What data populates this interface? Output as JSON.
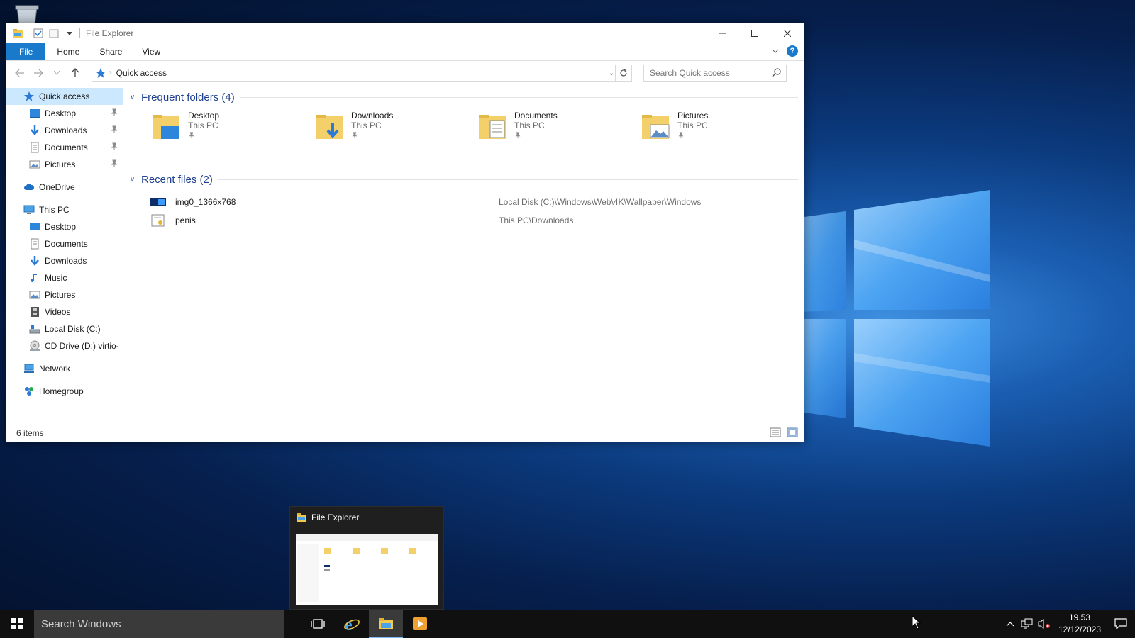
{
  "window": {
    "title": "File Explorer"
  },
  "ribbon": {
    "tabs": [
      "File",
      "Home",
      "Share",
      "View"
    ]
  },
  "address": {
    "crumb": "Quick access",
    "search_placeholder": "Search Quick access"
  },
  "nav": {
    "quick_access": "Quick access",
    "qa_desktop": "Desktop",
    "qa_downloads": "Downloads",
    "qa_documents": "Documents",
    "qa_pictures": "Pictures",
    "onedrive": "OneDrive",
    "this_pc": "This PC",
    "pc_desktop": "Desktop",
    "pc_documents": "Documents",
    "pc_downloads": "Downloads",
    "pc_music": "Music",
    "pc_pictures": "Pictures",
    "pc_videos": "Videos",
    "pc_local_disk": "Local Disk (C:)",
    "pc_cd_drive": "CD Drive (D:) virtio-",
    "network": "Network",
    "homegroup": "Homegroup"
  },
  "frequent": {
    "header": "Frequent folders (4)",
    "items": [
      {
        "name": "Desktop",
        "location": "This PC",
        "icon": "desktop-folder"
      },
      {
        "name": "Downloads",
        "location": "This PC",
        "icon": "downloads-folder"
      },
      {
        "name": "Documents",
        "location": "This PC",
        "icon": "documents-folder"
      },
      {
        "name": "Pictures",
        "location": "This PC",
        "icon": "pictures-folder"
      }
    ]
  },
  "recent": {
    "header": "Recent files (2)",
    "items": [
      {
        "name": "img0_1366x768",
        "path": "Local Disk (C:)\\Windows\\Web\\4K\\Wallpaper\\Windows",
        "icon": "image-file"
      },
      {
        "name": "penis",
        "path": "This PC\\Downloads",
        "icon": "certificate-file"
      }
    ]
  },
  "status": {
    "count": "6 items"
  },
  "taskbar": {
    "search_placeholder": "Search Windows",
    "preview_title": "File Explorer",
    "clock_time": "19.53",
    "clock_date": "12/12/2023"
  },
  "colors": {
    "accent": "#1979ca",
    "selection": "#cce8ff",
    "group_header": "#1e3f8f",
    "taskbar": "#101010"
  }
}
